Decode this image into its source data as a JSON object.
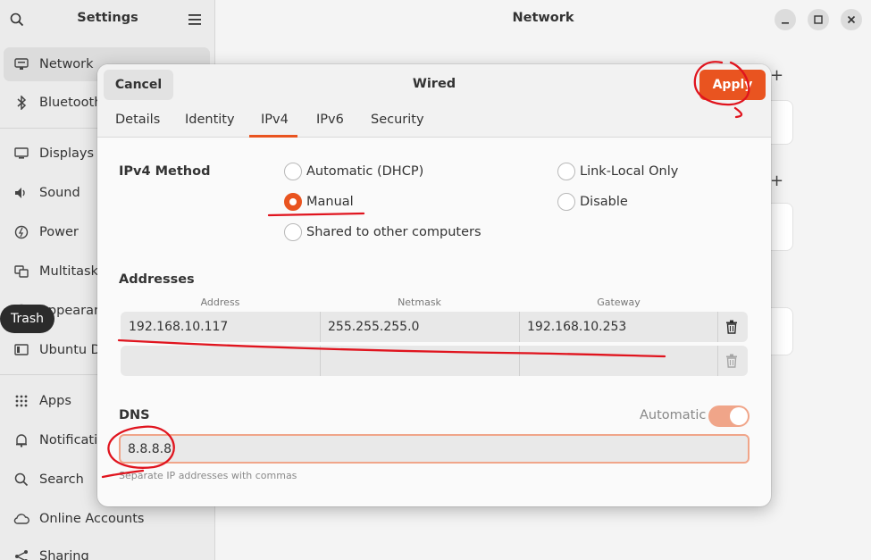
{
  "sidebar": {
    "title": "Settings",
    "items": [
      {
        "label": "Network",
        "icon": "network-icon",
        "active": true
      },
      {
        "label": "Bluetooth",
        "icon": "bluetooth-icon"
      },
      {
        "label": "Displays",
        "icon": "display-icon"
      },
      {
        "label": "Sound",
        "icon": "sound-icon"
      },
      {
        "label": "Power",
        "icon": "power-icon"
      },
      {
        "label": "Multitasking",
        "icon": "multitasking-icon"
      },
      {
        "label": "Appearance",
        "icon": "appearance-icon"
      },
      {
        "label": "Ubuntu Desktop",
        "icon": "ubuntu-desktop-icon"
      },
      {
        "label": "Apps",
        "icon": "apps-icon"
      },
      {
        "label": "Notifications",
        "icon": "bell-icon"
      },
      {
        "label": "Search",
        "icon": "search-icon"
      },
      {
        "label": "Online Accounts",
        "icon": "cloud-icon"
      },
      {
        "label": "Sharing",
        "icon": "share-icon"
      }
    ]
  },
  "main": {
    "title": "Network"
  },
  "tooltip": {
    "label": "Trash"
  },
  "dialog": {
    "cancel_label": "Cancel",
    "title": "Wired",
    "apply_label": "Apply",
    "tabs": [
      {
        "label": "Details"
      },
      {
        "label": "Identity"
      },
      {
        "label": "IPv4",
        "active": true
      },
      {
        "label": "IPv6"
      },
      {
        "label": "Security"
      }
    ],
    "ipv4_method": {
      "label": "IPv4 Method",
      "options": [
        {
          "label": "Automatic (DHCP)",
          "checked": false
        },
        {
          "label": "Manual",
          "checked": true
        },
        {
          "label": "Shared to other computers",
          "checked": false
        },
        {
          "label": "Link-Local Only",
          "checked": false
        },
        {
          "label": "Disable",
          "checked": false
        }
      ]
    },
    "addresses": {
      "label": "Addresses",
      "columns": [
        "Address",
        "Netmask",
        "Gateway"
      ],
      "rows": [
        {
          "address": "192.168.10.117",
          "netmask": "255.255.255.0",
          "gateway": "192.168.10.253"
        },
        {
          "address": "",
          "netmask": "",
          "gateway": ""
        }
      ]
    },
    "dns": {
      "label": "DNS",
      "automatic_label": "Automatic",
      "automatic_on": true,
      "value": "8.8.8.8",
      "hint": "Separate IP addresses with commas"
    }
  },
  "colors": {
    "accent": "#e95420",
    "annotation": "#e0141e"
  }
}
